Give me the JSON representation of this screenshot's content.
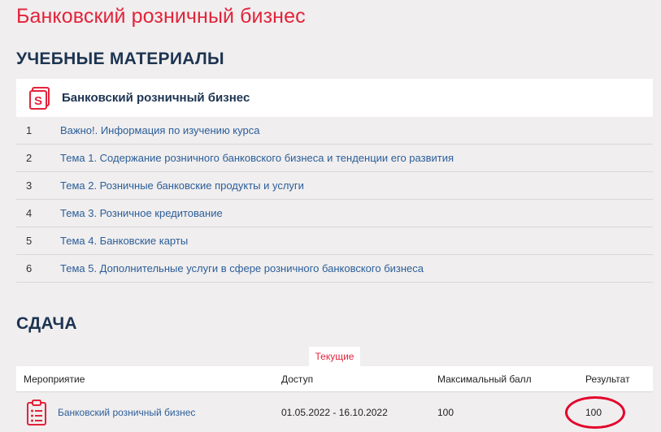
{
  "page": {
    "title": "Банковский розничный бизнес"
  },
  "materials": {
    "section_title": "УЧЕБНЫЕ МАТЕРИАЛЫ",
    "course_name": "Банковский розничный бизнес",
    "course_icon": "course-s-icon",
    "items": [
      {
        "num": "1",
        "label": "Важно!. Информация по изучению курса"
      },
      {
        "num": "2",
        "label": "Тема 1. Содержание розничного банковского бизнеса и тенденции его развития"
      },
      {
        "num": "3",
        "label": "Тема 2. Розничные банковские продукты и услуги"
      },
      {
        "num": "4",
        "label": "Тема 3. Розничное кредитование"
      },
      {
        "num": "5",
        "label": "Тема 4. Банковские карты"
      },
      {
        "num": "6",
        "label": "Тема 5. Дополнительные услуги в сфере розничного банковского бизнеса"
      }
    ]
  },
  "submission": {
    "section_title": "СДАЧА",
    "tab_label": "Текущие",
    "columns": [
      "Мероприятие",
      "Доступ",
      "Максимальный балл",
      "Результат"
    ],
    "rows": [
      {
        "event": "Банковский розничный бизнес",
        "access": "01.05.2022 - 16.10.2022",
        "max_score": "100",
        "result": "100"
      }
    ],
    "row_icon": "clipboard-list-icon"
  },
  "colors": {
    "accent_red": "#e2233b",
    "heading_navy": "#1d3451",
    "link_blue": "#2b5e9a",
    "background": "#f0eeee"
  }
}
